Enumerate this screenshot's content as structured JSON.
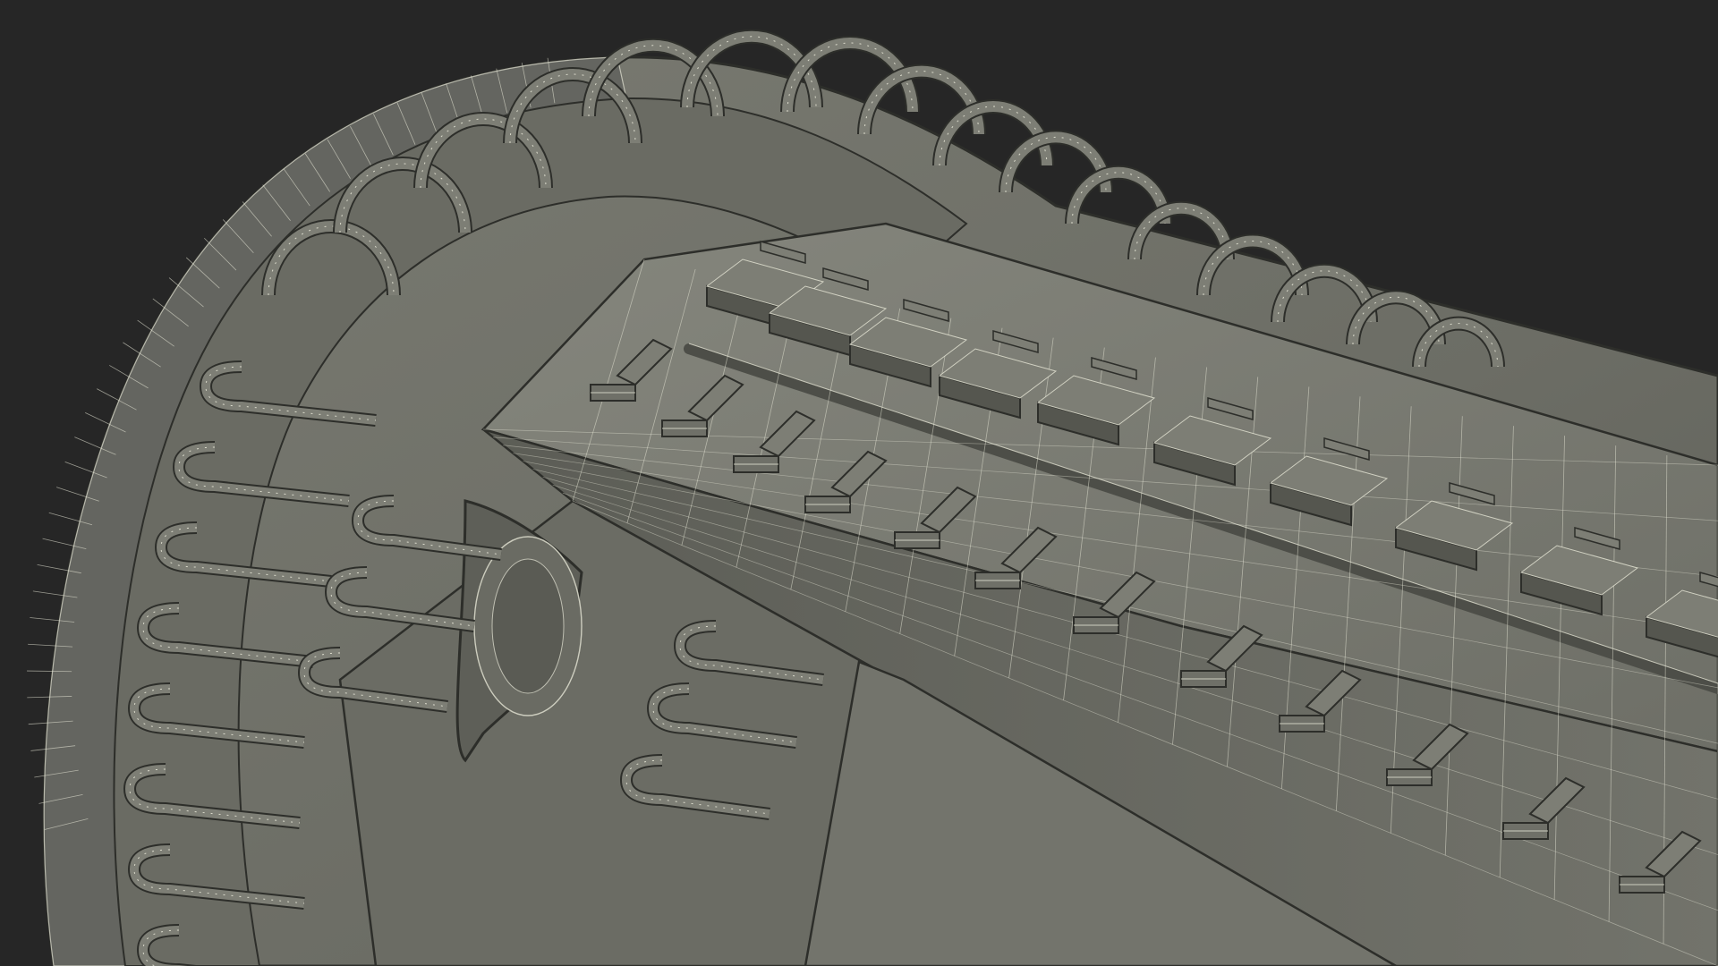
{
  "scene": {
    "subject": "wireframe-3d-model-render",
    "colors": {
      "background": "#262626",
      "surface": "#6f7068",
      "surface_light": "#7d7e75",
      "surface_dark": "#55564f",
      "wire": "#e6e6d6",
      "edge": "#2d2e2a"
    }
  }
}
